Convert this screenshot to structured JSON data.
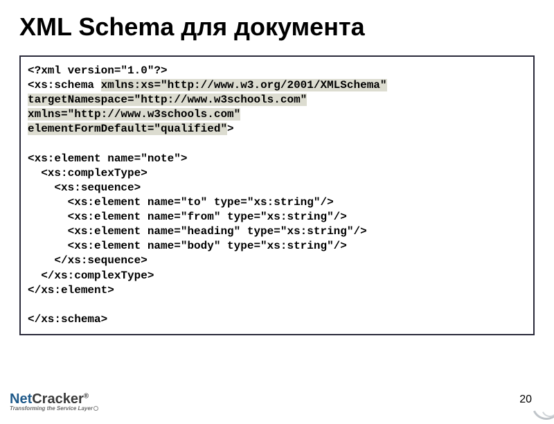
{
  "title": "XML Schema для документа",
  "code": {
    "l1": "<?xml version=\"1.0\"?>",
    "l2a": "<xs:schema ",
    "l2b": "xmlns:xs=\"http://www.w3.org/2001/XMLSchema\"",
    "l3": "targetNamespace=\"http://www.w3schools.com\"",
    "l4": "xmlns=\"http://www.w3schools.com\"",
    "l5": "elementFormDefault=\"qualified\"",
    "l5b": ">",
    "l6": "",
    "l7": "<xs:element name=\"note\">",
    "l8": "  <xs:complexType>",
    "l9": "    <xs:sequence>",
    "l10": "      <xs:element name=\"to\" type=\"xs:string\"/>",
    "l11": "      <xs:element name=\"from\" type=\"xs:string\"/>",
    "l12": "      <xs:element name=\"heading\" type=\"xs:string\"/>",
    "l13": "      <xs:element name=\"body\" type=\"xs:string\"/>",
    "l14": "    </xs:sequence>",
    "l15": "  </xs:complexType>",
    "l16": "</xs:element>",
    "l17": "",
    "l18": "</xs:schema>"
  },
  "pageNumber": "20",
  "logo": {
    "namePartA": "Net",
    "namePartB": "Cracker",
    "reg": "®",
    "tagline": "Transforming the Service Layer"
  }
}
